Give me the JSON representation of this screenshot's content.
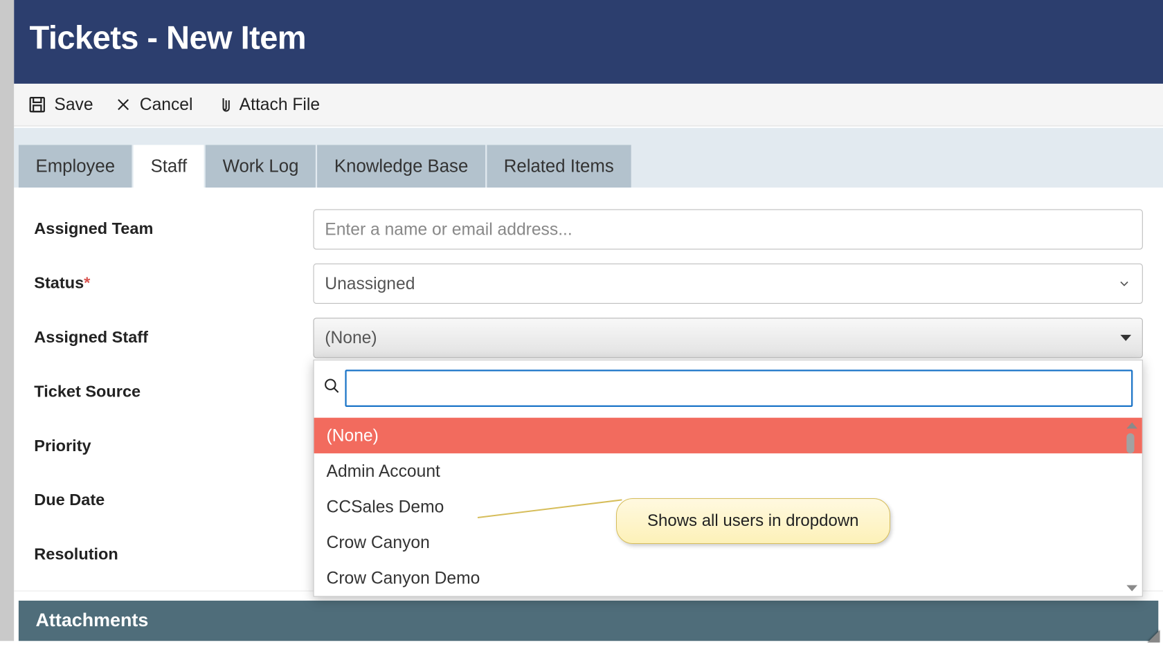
{
  "header": {
    "title": "Tickets - New Item"
  },
  "toolbar": {
    "save_label": "Save",
    "cancel_label": "Cancel",
    "attach_label": "Attach File"
  },
  "tabs": {
    "employee": "Employee",
    "staff": "Staff",
    "worklog": "Work Log",
    "kb": "Knowledge Base",
    "related": "Related Items"
  },
  "form": {
    "assigned_team_label": "Assigned Team",
    "assigned_team_placeholder": "Enter a name or email address...",
    "status_label": "Status",
    "status_value": "Unassigned",
    "assigned_staff_label": "Assigned Staff",
    "assigned_staff_value": "(None)",
    "ticket_source_label": "Ticket Source",
    "priority_label": "Priority",
    "due_date_label": "Due Date",
    "resolution_label": "Resolution"
  },
  "dropdown": {
    "search_value": "",
    "none_option": "(None)",
    "opt1": "Admin Account",
    "opt2": "CCSales Demo",
    "opt3": "Crow Canyon",
    "opt4": "Crow Canyon Demo"
  },
  "attachments": {
    "label": "Attachments"
  },
  "callout": {
    "text": "Shows all users in dropdown"
  }
}
